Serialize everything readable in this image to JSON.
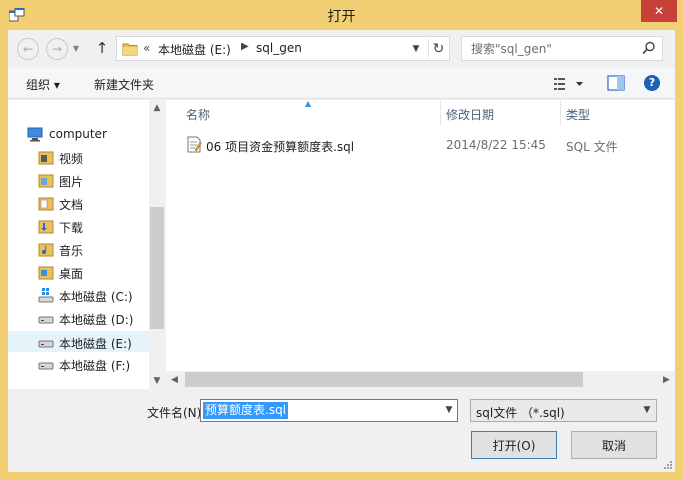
{
  "window": {
    "title": "打开",
    "close_label": "✕"
  },
  "nav": {
    "back_label": "←",
    "forward_label": "→",
    "up_label": "↑"
  },
  "address": {
    "chevron": "«",
    "segments": [
      "本地磁盘 (E:)",
      "sql_gen"
    ]
  },
  "search": {
    "placeholder": "搜索\"sql_gen\""
  },
  "toolbar": {
    "organize_label": "组织 ▾",
    "new_folder_label": "新建文件夹"
  },
  "sidebar": {
    "items": [
      {
        "label": "computer",
        "icon": "computer-icon"
      },
      {
        "label": "视频",
        "icon": "videos-folder-icon"
      },
      {
        "label": "图片",
        "icon": "pictures-folder-icon"
      },
      {
        "label": "文档",
        "icon": "documents-folder-icon"
      },
      {
        "label": "下载",
        "icon": "downloads-folder-icon"
      },
      {
        "label": "音乐",
        "icon": "music-folder-icon"
      },
      {
        "label": "桌面",
        "icon": "desktop-folder-icon"
      },
      {
        "label": "本地磁盘 (C:)",
        "icon": "system-drive-icon"
      },
      {
        "label": "本地磁盘 (D:)",
        "icon": "drive-icon"
      },
      {
        "label": "本地磁盘 (E:)",
        "icon": "drive-icon",
        "selected": true
      },
      {
        "label": "本地磁盘 (F:)",
        "icon": "drive-icon"
      }
    ]
  },
  "filelist": {
    "columns": {
      "name": "名称",
      "modified": "修改日期",
      "type": "类型"
    },
    "files": [
      {
        "name": "06 项目资金预算额度表.sql",
        "modified": "2014/8/22 15:45",
        "type": "SQL 文件",
        "icon": "sql-file-icon"
      }
    ]
  },
  "footer": {
    "filename_label": "文件名(N):",
    "filename_value": "预算额度表.sql",
    "filetype_value": "sql文件 （*.sql)",
    "open_label": "打开(O)",
    "cancel_label": "取消"
  },
  "colors": {
    "title_bar": "#f2cf72",
    "close_button": "#c7413a",
    "selection": "#3399ff",
    "nav_selected": "#e5f3fb"
  }
}
